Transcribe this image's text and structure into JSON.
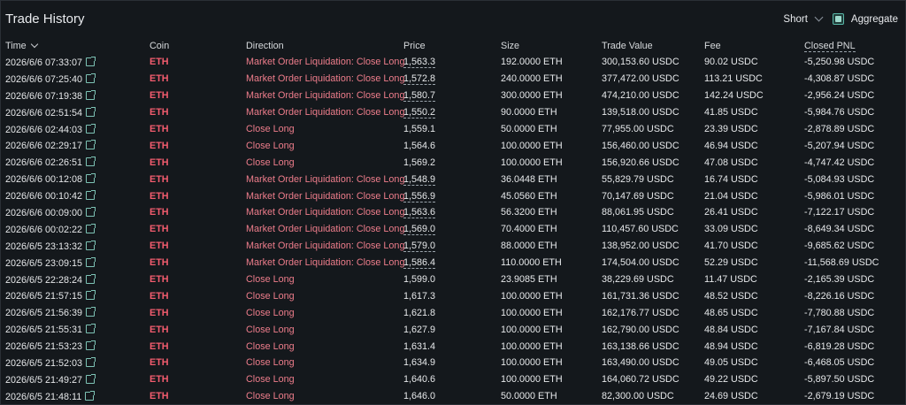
{
  "header": {
    "title": "Trade History",
    "direction_filter": "Short",
    "aggregate_label": "Aggregate",
    "aggregate_checked": true
  },
  "columns": {
    "time": "Time",
    "coin": "Coin",
    "direction": "Direction",
    "price": "Price",
    "size": "Size",
    "trade_value": "Trade Value",
    "fee": "Fee",
    "closed_pnl": "Closed PNL"
  },
  "colors": {
    "coin": "#f25c6e",
    "direction": "#ee7d8b",
    "link_icon": "#7ec4b6",
    "background": "#14181c"
  },
  "icons": {
    "time_sort": "chevron-down-icon",
    "external_link": "external-link-icon",
    "filter_dropdown": "chevron-down-icon",
    "checkbox": "checkbox-checked-icon"
  },
  "rows": [
    {
      "time": "2026/6/6 07:33:07",
      "coin": "ETH",
      "direction": "Market Order Liquidation: Close Long",
      "price": "1,563.3",
      "price_dashed": true,
      "size": "192.0000 ETH",
      "value": "300,153.60 USDC",
      "fee": "90.02 USDC",
      "pnl": "-5,250.98 USDC"
    },
    {
      "time": "2026/6/6 07:25:40",
      "coin": "ETH",
      "direction": "Market Order Liquidation: Close Long",
      "price": "1,572.8",
      "price_dashed": true,
      "size": "240.0000 ETH",
      "value": "377,472.00 USDC",
      "fee": "113.21 USDC",
      "pnl": "-4,308.87 USDC"
    },
    {
      "time": "2026/6/6 07:19:38",
      "coin": "ETH",
      "direction": "Market Order Liquidation: Close Long",
      "price": "1,580.7",
      "price_dashed": true,
      "size": "300.0000 ETH",
      "value": "474,210.00 USDC",
      "fee": "142.24 USDC",
      "pnl": "-2,956.24 USDC"
    },
    {
      "time": "2026/6/6 02:51:54",
      "coin": "ETH",
      "direction": "Market Order Liquidation: Close Long",
      "price": "1,550.2",
      "price_dashed": true,
      "size": "90.0000 ETH",
      "value": "139,518.00 USDC",
      "fee": "41.85 USDC",
      "pnl": "-5,984.76 USDC"
    },
    {
      "time": "2026/6/6 02:44:03",
      "coin": "ETH",
      "direction": "Close Long",
      "price": "1,559.1",
      "price_dashed": false,
      "size": "50.0000 ETH",
      "value": "77,955.00 USDC",
      "fee": "23.39 USDC",
      "pnl": "-2,878.89 USDC"
    },
    {
      "time": "2026/6/6 02:29:17",
      "coin": "ETH",
      "direction": "Close Long",
      "price": "1,564.6",
      "price_dashed": false,
      "size": "100.0000 ETH",
      "value": "156,460.00 USDC",
      "fee": "46.94 USDC",
      "pnl": "-5,207.94 USDC"
    },
    {
      "time": "2026/6/6 02:26:51",
      "coin": "ETH",
      "direction": "Close Long",
      "price": "1,569.2",
      "price_dashed": false,
      "size": "100.0000 ETH",
      "value": "156,920.66 USDC",
      "fee": "47.08 USDC",
      "pnl": "-4,747.42 USDC"
    },
    {
      "time": "2026/6/6 00:12:08",
      "coin": "ETH",
      "direction": "Market Order Liquidation: Close Long",
      "price": "1,548.9",
      "price_dashed": true,
      "size": "36.0448 ETH",
      "value": "55,829.79 USDC",
      "fee": "16.74 USDC",
      "pnl": "-5,084.93 USDC"
    },
    {
      "time": "2026/6/6 00:10:42",
      "coin": "ETH",
      "direction": "Market Order Liquidation: Close Long",
      "price": "1,556.9",
      "price_dashed": true,
      "size": "45.0560 ETH",
      "value": "70,147.69 USDC",
      "fee": "21.04 USDC",
      "pnl": "-5,986.01 USDC"
    },
    {
      "time": "2026/6/6 00:09:00",
      "coin": "ETH",
      "direction": "Market Order Liquidation: Close Long",
      "price": "1,563.6",
      "price_dashed": true,
      "size": "56.3200 ETH",
      "value": "88,061.95 USDC",
      "fee": "26.41 USDC",
      "pnl": "-7,122.17 USDC"
    },
    {
      "time": "2026/6/6 00:02:22",
      "coin": "ETH",
      "direction": "Market Order Liquidation: Close Long",
      "price": "1,569.0",
      "price_dashed": true,
      "size": "70.4000 ETH",
      "value": "110,457.60 USDC",
      "fee": "33.09 USDC",
      "pnl": "-8,649.34 USDC"
    },
    {
      "time": "2026/6/5 23:13:32",
      "coin": "ETH",
      "direction": "Market Order Liquidation: Close Long",
      "price": "1,579.0",
      "price_dashed": true,
      "size": "88.0000 ETH",
      "value": "138,952.00 USDC",
      "fee": "41.70 USDC",
      "pnl": "-9,685.62 USDC"
    },
    {
      "time": "2026/6/5 23:09:15",
      "coin": "ETH",
      "direction": "Market Order Liquidation: Close Long",
      "price": "1,586.4",
      "price_dashed": true,
      "size": "110.0000 ETH",
      "value": "174,504.00 USDC",
      "fee": "52.29 USDC",
      "pnl": "-11,568.69 USDC"
    },
    {
      "time": "2026/6/5 22:28:24",
      "coin": "ETH",
      "direction": "Close Long",
      "price": "1,599.0",
      "price_dashed": false,
      "size": "23.9085 ETH",
      "value": "38,229.69 USDC",
      "fee": "11.47 USDC",
      "pnl": "-2,165.39 USDC"
    },
    {
      "time": "2026/6/5 21:57:15",
      "coin": "ETH",
      "direction": "Close Long",
      "price": "1,617.3",
      "price_dashed": false,
      "size": "100.0000 ETH",
      "value": "161,731.36 USDC",
      "fee": "48.52 USDC",
      "pnl": "-8,226.16 USDC"
    },
    {
      "time": "2026/6/5 21:56:39",
      "coin": "ETH",
      "direction": "Close Long",
      "price": "1,621.8",
      "price_dashed": false,
      "size": "100.0000 ETH",
      "value": "162,176.77 USDC",
      "fee": "48.65 USDC",
      "pnl": "-7,780.88 USDC"
    },
    {
      "time": "2026/6/5 21:55:31",
      "coin": "ETH",
      "direction": "Close Long",
      "price": "1,627.9",
      "price_dashed": false,
      "size": "100.0000 ETH",
      "value": "162,790.00 USDC",
      "fee": "48.84 USDC",
      "pnl": "-7,167.84 USDC"
    },
    {
      "time": "2026/6/5 21:53:23",
      "coin": "ETH",
      "direction": "Close Long",
      "price": "1,631.4",
      "price_dashed": false,
      "size": "100.0000 ETH",
      "value": "163,138.66 USDC",
      "fee": "48.94 USDC",
      "pnl": "-6,819.28 USDC"
    },
    {
      "time": "2026/6/5 21:52:03",
      "coin": "ETH",
      "direction": "Close Long",
      "price": "1,634.9",
      "price_dashed": false,
      "size": "100.0000 ETH",
      "value": "163,490.00 USDC",
      "fee": "49.05 USDC",
      "pnl": "-6,468.05 USDC"
    },
    {
      "time": "2026/6/5 21:49:27",
      "coin": "ETH",
      "direction": "Close Long",
      "price": "1,640.6",
      "price_dashed": false,
      "size": "100.0000 ETH",
      "value": "164,060.72 USDC",
      "fee": "49.22 USDC",
      "pnl": "-5,897.50 USDC"
    },
    {
      "time": "2026/6/5 21:48:11",
      "coin": "ETH",
      "direction": "Close Long",
      "price": "1,646.0",
      "price_dashed": false,
      "size": "50.0000 ETH",
      "value": "82,300.00 USDC",
      "fee": "24.69 USDC",
      "pnl": "-2,679.19 USDC"
    }
  ]
}
